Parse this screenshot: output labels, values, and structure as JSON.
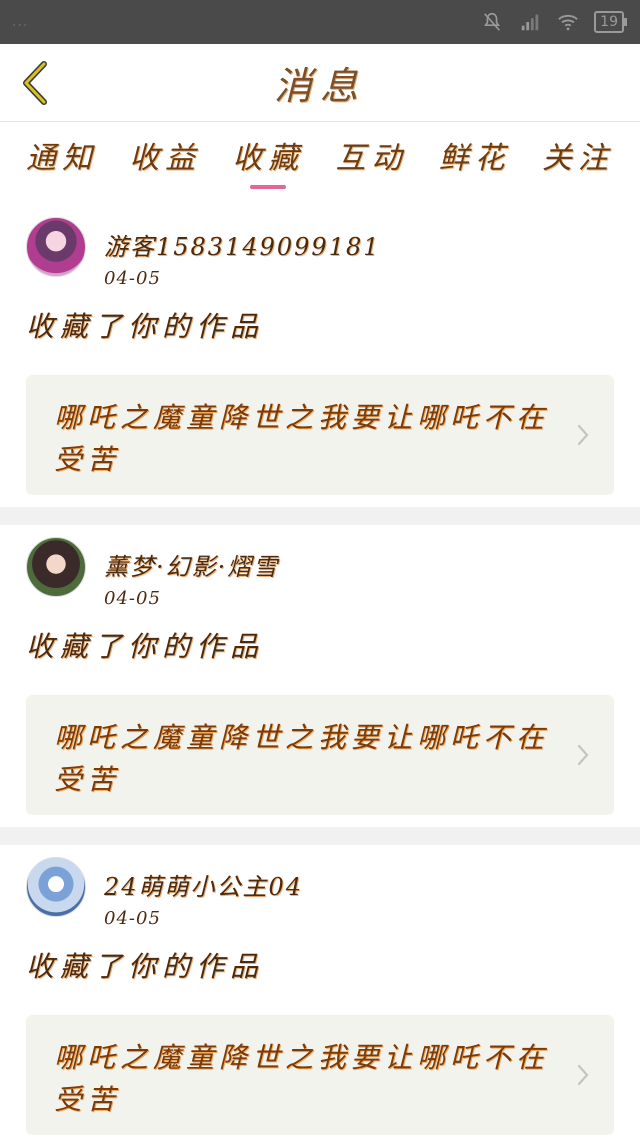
{
  "status_bar": {
    "left_text": "...",
    "battery": "19"
  },
  "header": {
    "title": "消息"
  },
  "tabs": [
    {
      "label": "通知",
      "active": false
    },
    {
      "label": "收益",
      "active": false
    },
    {
      "label": "收藏",
      "active": true
    },
    {
      "label": "互动",
      "active": false
    },
    {
      "label": "鲜花",
      "active": false
    },
    {
      "label": "关注",
      "active": false
    }
  ],
  "feed": [
    {
      "username": "游客15831490991​81",
      "date": "04-05",
      "action": "收藏了你的作品",
      "work_title": "哪吒之魔童降世之我要让哪吒不在受苦"
    },
    {
      "username": "薰梦·幻影·熠雪",
      "date": "04-05",
      "action": "收藏了你的作品",
      "work_title": "哪吒之魔童降世之我要让哪吒不在受苦"
    },
    {
      "username": "24萌萌小公主04",
      "date": "04-05",
      "action": "收藏了你的作品",
      "work_title": "哪吒之魔童降世之我要让哪吒不在受苦"
    }
  ],
  "colors": {
    "accent": "#e2669a",
    "status_bar_bg": "#4a4a4a",
    "back_arrow": "#c9b21a",
    "card_box_bg": "#f3f3ee"
  }
}
